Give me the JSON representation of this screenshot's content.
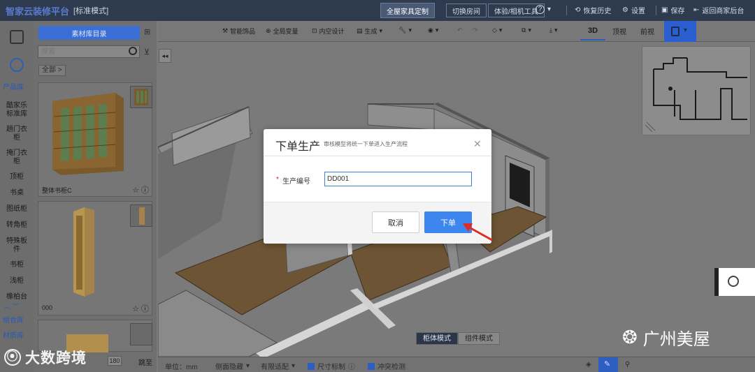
{
  "topbar": {
    "brand": "智家云装修平台",
    "mode": "[标准模式]",
    "center_tab": "全屋家具定制",
    "switch_room": "切换房间",
    "experience_tools": "体验/相机工具",
    "help": "?",
    "history": "恢复历史",
    "settings": "设置",
    "save": "保存",
    "back": "返回商家后台"
  },
  "rail": {
    "library_title": "产品库",
    "items": [
      "酷家乐标准库",
      "趟门衣柜",
      "掩门衣柜",
      "顶柜",
      "书桌",
      "图纸柜",
      "转角柜",
      "特殊板件",
      "书柜",
      "浅柜",
      "橡柏台"
    ],
    "group_lib": "组合库",
    "material_lib": "材质库"
  },
  "panel": {
    "catalog_button": "素材库目录",
    "search_placeholder": "搜索",
    "breadcrumb": "全部 >",
    "cards": [
      {
        "name": "整体书柜C"
      },
      {
        "name": "000"
      }
    ],
    "page_size": "180",
    "go": "跳至"
  },
  "toolbar": {
    "items": [
      "智能饰品",
      "全局变量",
      "内空设计",
      "生成",
      "",
      "",
      "",
      "",
      "",
      ""
    ],
    "view_3d": "3D",
    "view_top": "顶视",
    "view_front": "前视"
  },
  "mode_switch": {
    "cabinet": "柜体模式",
    "component": "组件模式"
  },
  "statusbar": {
    "unit": "单位：mm",
    "wall_line": "侧面隐藏",
    "snap": "有限适配",
    "dim_label": "尺寸标制",
    "collision": "冲突检测"
  },
  "modal": {
    "title": "下单生产",
    "subtitle": "审核模型将统一下单进入生产流程",
    "field_label": "生产编号",
    "field_value": "DD001",
    "cancel": "取消",
    "confirm": "下单"
  },
  "watermark": {
    "left": "大数跨境",
    "right": "广州美屋"
  },
  "colors": {
    "accent": "#3d86f0",
    "topbar": "#2e3a4d",
    "arrow": "#e02a2a"
  }
}
